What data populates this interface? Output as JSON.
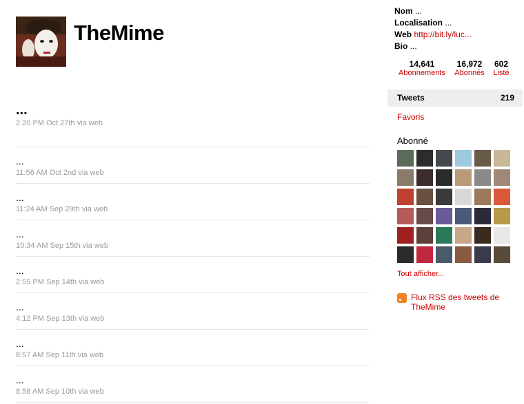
{
  "profile": {
    "username": "TheMime"
  },
  "tweets": [
    {
      "text": "...",
      "time": "2:20 PM Oct 27th",
      "via": "via web"
    },
    {
      "text": "...",
      "time": "11:56 AM Oct 2nd",
      "via": "via web"
    },
    {
      "text": "...",
      "time": "11:24 AM Sep 29th",
      "via": "via web"
    },
    {
      "text": "...",
      "time": "10:34 AM Sep 15th",
      "via": "via web"
    },
    {
      "text": "...",
      "time": "2:55 PM Sep 14th",
      "via": "via web"
    },
    {
      "text": "...",
      "time": "4:12 PM Sep 13th",
      "via": "via web"
    },
    {
      "text": "...",
      "time": "8:57 AM Sep 11th",
      "via": "via web"
    },
    {
      "text": "...",
      "time": "8:58 AM Sep 10th",
      "via": "via web"
    }
  ],
  "sidebar": {
    "bio": {
      "name_label": "Nom",
      "name_value": "...",
      "location_label": "Localisation",
      "location_value": "...",
      "web_label": "Web",
      "web_value": "http://bit.ly/luc...",
      "bio_label": "Bio",
      "bio_value": "..."
    },
    "stats": [
      {
        "number": "14,641",
        "label": "Abonnements"
      },
      {
        "number": "16,972",
        "label": "Abonnés"
      },
      {
        "number": "602",
        "label": "Listé"
      }
    ],
    "tweets_tab": {
      "label": "Tweets",
      "count": "219"
    },
    "favorites_label": "Favoris",
    "following_title": "Abonné",
    "view_all_label": "Tout afficher...",
    "rss_label": "Flux RSS des tweets de TheMime"
  },
  "colors": {
    "link": "#cc0000",
    "meta": "#999999"
  }
}
